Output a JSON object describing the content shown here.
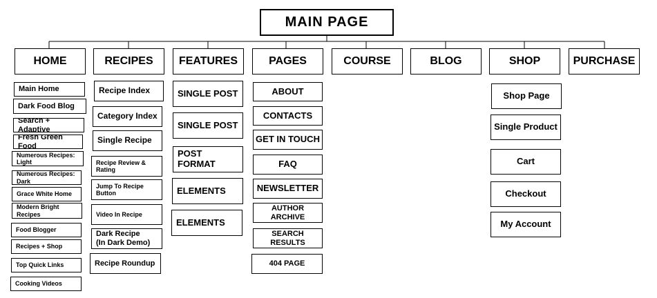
{
  "root": {
    "label": "MAIN  PAGE"
  },
  "categories": [
    {
      "id": "home",
      "label": "HOME",
      "items": [
        "Main Home",
        "Dark Food Blog",
        "Search + Adaptive",
        "Fresh Green Food",
        "Numerous Recipes: Light",
        "Numerous Recipes: Dark",
        "Grace White Home",
        "Modern Bright Recipes",
        "Food Blogger",
        "Recipes + Shop",
        "Top Quick Links",
        "Cooking Videos"
      ]
    },
    {
      "id": "recipes",
      "label": "RECIPES",
      "items": [
        "Recipe Index",
        "Category Index",
        "Single Recipe",
        "Recipe Review & Rating",
        "Jump To Recipe Button",
        "Video In Recipe",
        "Dark Recipe\n(In Dark Demo)",
        "Recipe Roundup"
      ]
    },
    {
      "id": "features",
      "label": "FEATURES",
      "items": [
        "SINGLE POST",
        "SINGLE POST",
        "POST FORMAT",
        "ELEMENTS",
        "ELEMENTS"
      ]
    },
    {
      "id": "pages",
      "label": "PAGES",
      "items": [
        "ABOUT",
        "CONTACTS",
        "GET IN TOUCH",
        "FAQ",
        "NEWSLETTER",
        "AUTHOR ARCHIVE",
        "SEARCH RESULTS",
        "404 PAGE"
      ]
    },
    {
      "id": "course",
      "label": "COURSE",
      "items": []
    },
    {
      "id": "blog",
      "label": "BLOG",
      "items": []
    },
    {
      "id": "shop",
      "label": "SHOP",
      "items": [
        "Shop Page",
        "Single Product",
        "Cart",
        "Checkout",
        "My Account"
      ]
    },
    {
      "id": "purchase",
      "label": "PURCHASE",
      "items": []
    }
  ]
}
